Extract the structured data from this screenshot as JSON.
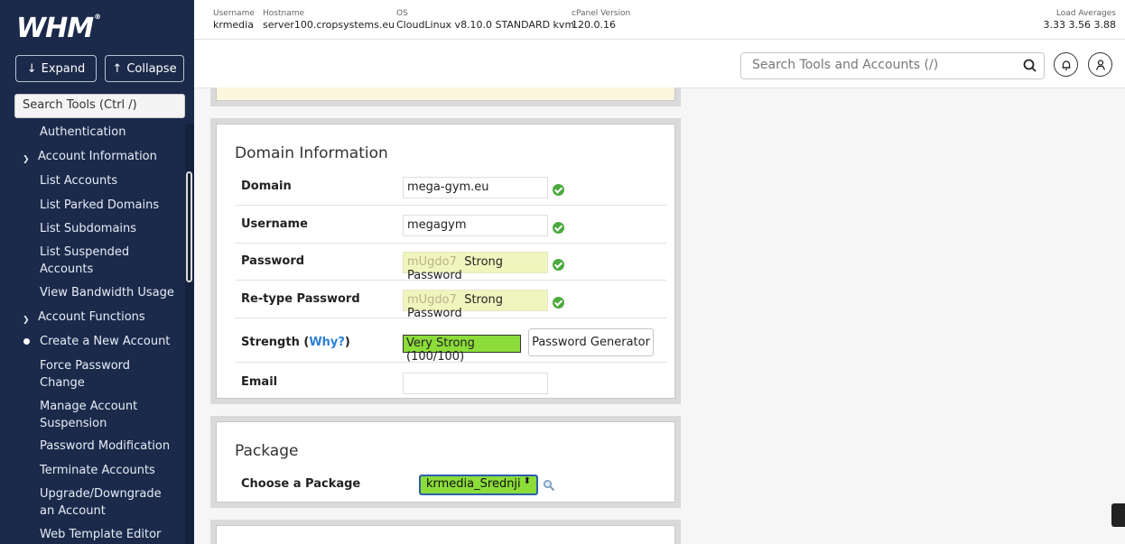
{
  "sidebar": {
    "logo": "WHM",
    "expand_label": "Expand",
    "collapse_label": "Collapse",
    "search_placeholder": "Search Tools (Ctrl /)",
    "items": [
      {
        "label": "Authentication",
        "type": "item"
      },
      {
        "label": "Account Information",
        "type": "category"
      },
      {
        "label": "List Accounts",
        "type": "item"
      },
      {
        "label": "List Parked Domains",
        "type": "item"
      },
      {
        "label": "List Subdomains",
        "type": "item"
      },
      {
        "label": "List Suspended Accounts",
        "type": "item"
      },
      {
        "label": "View Bandwidth Usage",
        "type": "item"
      },
      {
        "label": "Account Functions",
        "type": "category"
      },
      {
        "label": "Create a New Account",
        "type": "item",
        "active": true
      },
      {
        "label": "Force Password Change",
        "type": "item"
      },
      {
        "label": "Manage Account Suspension",
        "type": "item"
      },
      {
        "label": "Password Modification",
        "type": "item"
      },
      {
        "label": "Terminate Accounts",
        "type": "item"
      },
      {
        "label": "Upgrade/Downgrade an Account",
        "type": "item"
      },
      {
        "label": "Web Template Editor",
        "type": "item"
      }
    ]
  },
  "header": {
    "username_label": "Username",
    "username": "krmedia",
    "hostname_label": "Hostname",
    "hostname": "server100.cropsystems.eu",
    "os_label": "OS",
    "os": "CloudLinux v8.10.0 STANDARD kvm",
    "cpanel_label": "cPanel Version",
    "cpanel_version": "120.0.16",
    "load_label": "Load Averages",
    "load_averages": "3.33  3.56  3.88"
  },
  "toolbar": {
    "search_placeholder": "Search Tools and Accounts (/)"
  },
  "domain_info": {
    "title": "Domain Information",
    "domain_label": "Domain",
    "domain_value": "mega-gym.eu",
    "username_label": "Username",
    "username_value": "megagym",
    "password_label": "Password",
    "password_mask": "mUgdo7",
    "password_strength_text": "Strong Password",
    "retype_label": "Re-type Password",
    "retype_mask": "mUgdo7",
    "retype_strength_text": "Strong Password",
    "strength_label": "Strength (",
    "strength_why": "Why?",
    "strength_close": ")",
    "strength_value": "Very Strong (100/100)",
    "password_generator_label": "Password Generator",
    "email_label": "Email",
    "email_value": ""
  },
  "package": {
    "title": "Package",
    "choose_label": "Choose a Package",
    "selected": "krmedia_Srednji"
  },
  "colors": {
    "sidebar_bg": "#1b2a4b",
    "strength_green": "#8cdc3a",
    "password_highlight": "#f0f5bd",
    "check_green": "#4caa3f",
    "link_blue": "#2a7fd4"
  }
}
